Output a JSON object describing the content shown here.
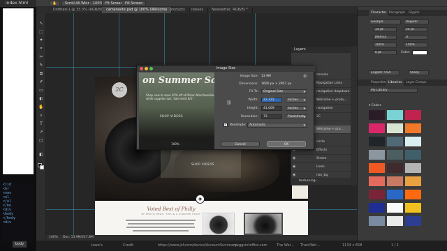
{
  "sidebar": {
    "file_tab": "index.html",
    "code_lines": [
      "<lid",
      "<hr",
      "<nav",
      "<ul",
      "</ul",
      "</bo",
      "<div",
      "<body",
      "</body",
      "<div"
    ],
    "status_tag": "body"
  },
  "options_bar": {
    "scroll_all": "Scroll All Windows",
    "zoom_level": "100%",
    "fit_screen": "Fit Screen",
    "fill_screen": "Fill Screen"
  },
  "doc_tabs": [
    "Untitled-1 @ 33.3% (RGB/8) *",
    "camerasite.psd @ 100% (Welcome",
    "products",
    "classes",
    "Newsletter, RGB/8) *"
  ],
  "tools": [
    "↖",
    "⬚",
    "✦",
    "⌖",
    "✂",
    "✎",
    "⧉",
    "✐",
    "▭",
    "◐",
    "✋",
    "⌕",
    "T",
    "↗",
    "▢",
    "◧"
  ],
  "canvas": {
    "logo": "2C",
    "shop_now": "SHOP VIDEOS",
    "voted": "Voted Best of Philly",
    "voted_sub": "BY PHOTO NEWS, THIS & A CURATED STORY",
    "camera_icon": "◉"
  },
  "layers": {
    "title": "Layers",
    "rows": [
      "console",
      "Navigation Links",
      "navigation dropdown",
      "Welcome + produ…",
      "navigation",
      "2C",
      "Welcome + pro…",
      "circle",
      "Effects",
      "Stroke",
      "Icons",
      "nav_bg",
      "texture-bg..."
    ]
  },
  "dialog": {
    "title": "Image Size",
    "preview_title": "on Summer Sa",
    "preview_sub": "Shop now to save 20% off all Nikon Merchandise while supplies last. Sale ends 8/1!",
    "preview_shop": "SHOP VIDEOS",
    "preview_zoom": "100%",
    "image_size_label": "Image Size:",
    "image_size_value": "13.9M",
    "dimensions_label": "Dimensions:",
    "dimensions_value": "1600 px × 2957 px",
    "fit_to_label": "Fit To:",
    "fit_to_value": "Original Size",
    "width_label": "Width:",
    "width_value": "22.222",
    "width_unit": "Inches",
    "height_label": "Height:",
    "height_value": "41.069",
    "height_unit": "Inches",
    "resolution_label": "Resolution:",
    "resolution_value": "72",
    "resolution_unit": "Pixels/Inch",
    "resample_label": "Resample:",
    "resample_value": "Automatic",
    "cancel": "Cancel",
    "ok": "OK"
  },
  "right_panel": {
    "top_tabs": [
      "Character",
      "Paragraph",
      "Glyphs"
    ],
    "font_family": "Georgia",
    "font_style": "Regular",
    "font_size": "14 pt",
    "leading": "24 pt",
    "kerning": "Metrics",
    "tracking": "0",
    "scale_v": "100%",
    "scale_h": "100%",
    "baseline": "0 pt",
    "color_label": "Color:",
    "language": "English: USA",
    "aa": "Sharp",
    "lib_tabs": [
      "Properties",
      "Libraries",
      "Layer Comps"
    ],
    "library_select": "My Library",
    "colors_label": "▾ Colors",
    "swatches": [
      "#2a1d28",
      "#7ad2d4",
      "#c0234e",
      "#d8286a",
      "#d7e4d2",
      "#f07a2a",
      "#1f2528",
      "#4f6a76",
      "#d9eef0",
      "#8c96a0",
      "#4b5f62",
      "#3f5f6a",
      "#f05a22",
      "#3f2a2c",
      "#b4b4b4",
      "#e46a5c",
      "#c97a62",
      "#e8a040",
      "#7a2438",
      "#2a68c8",
      "#ff6a10",
      "#1e2e92",
      "#fafafa",
      "#f0c020",
      "#7a8aa0",
      "#eaeaea",
      "#2d3e92"
    ]
  },
  "status": {
    "zoom": "100%",
    "doc": "Doc: 13.9M/247.8M"
  },
  "taskbar": {
    "items": [
      "Lowe's",
      "Credit",
      "https://www.jsf.com/device/AccountSummary",
      "meggsintoffire.com",
      "The Wei...",
      "Then/Wei..."
    ],
    "dimensions": "1134 x 658",
    "page": "1 / 1"
  },
  "colors": {
    "accent": "#2f67b0",
    "guide": "#3ab0d8"
  }
}
